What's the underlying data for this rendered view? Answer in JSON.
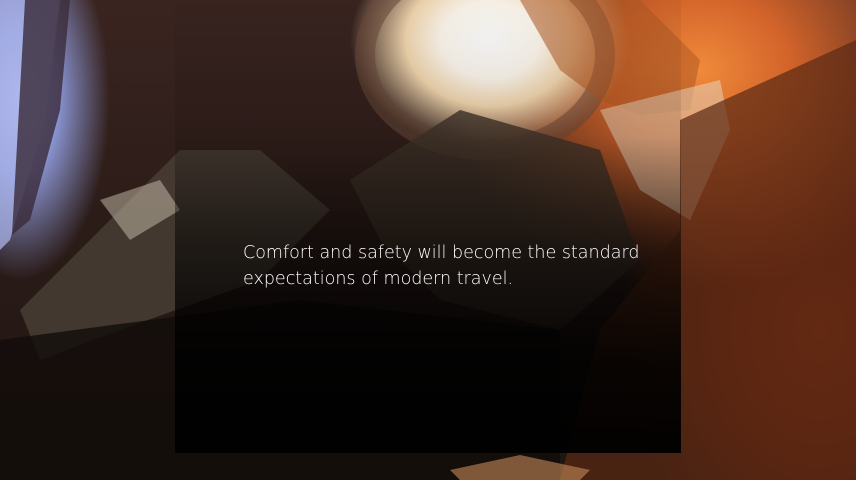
{
  "hero": {
    "quote": "Comfort and safety will become the standard expectations of modern travel."
  }
}
